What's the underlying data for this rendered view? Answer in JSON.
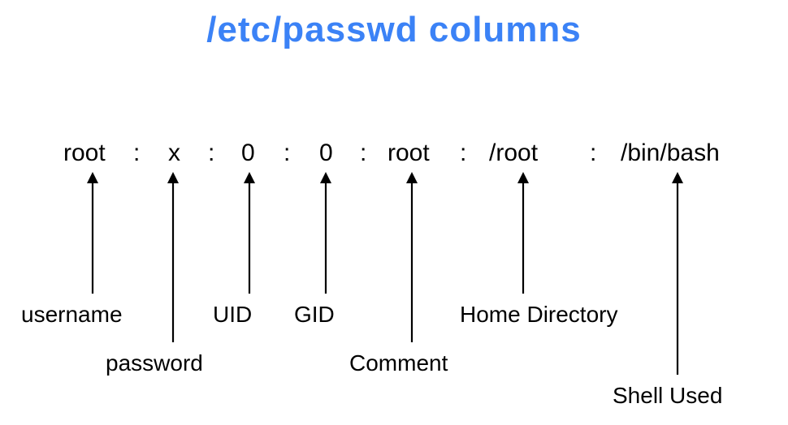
{
  "title": "/etc/passwd columns",
  "fields": {
    "user": "root",
    "pass": "x",
    "uid": "0",
    "gid": "0",
    "comment": "root",
    "home": "/root",
    "shell": "/bin/bash"
  },
  "separator": ":",
  "labels": {
    "user": "username",
    "pass": "password",
    "uid": "UID",
    "gid": "GID",
    "comment": "Comment",
    "home": "Home Directory",
    "shell": "Shell Used"
  }
}
